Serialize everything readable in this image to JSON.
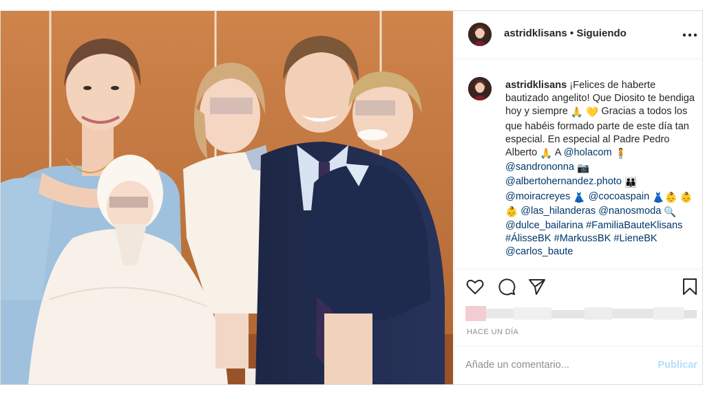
{
  "header": {
    "username": "astridklisans",
    "separator": " • ",
    "follow_status": "Siguiendo"
  },
  "caption": {
    "username": "astridklisans",
    "t1": " ¡Felices de haberte bautizado angelito! Que Diosito te bendiga hoy y siempre ",
    "t2": " Gracias a todos los que habéis formado parte de este día tan especial. En especial al Padre Pedro Alberto ",
    "t3": " A ",
    "m_holacom": "@holacom",
    "m_sandrononna": "@sandrononna",
    "m_alberto": "@albertohernandez.photo",
    "m_moira": "@moiracreyes",
    "m_cocoa": "@cocoaspain",
    "m_hilanderas": "@las_hilanderas",
    "m_nanos": "@nanosmoda",
    "m_dulce": "@dulce_bailarina",
    "h_familia": "#FamiliaBauteKlisans",
    "h_alisse": "#ÁlisseBK",
    "h_markuss": "#MarkussBK",
    "h_liene": "#LieneBK",
    "m_carlos": "@carlos_baute"
  },
  "emojis": [
    "praying-hands",
    "yellow-heart",
    "praying-hands",
    "person-icon",
    "camera",
    "family",
    "dress",
    "dress",
    "baby",
    "baby",
    "baby",
    "magnifying-glass"
  ],
  "timestamp": "HACE UN DÍA",
  "comment": {
    "placeholder": "Añade un comentario...",
    "publish_label": "Publicar"
  },
  "colors": {
    "link": "#00376b",
    "publish_disabled": "#b2dffc",
    "meta_gray": "#8e8e8e",
    "border": "#dbdbdb"
  }
}
